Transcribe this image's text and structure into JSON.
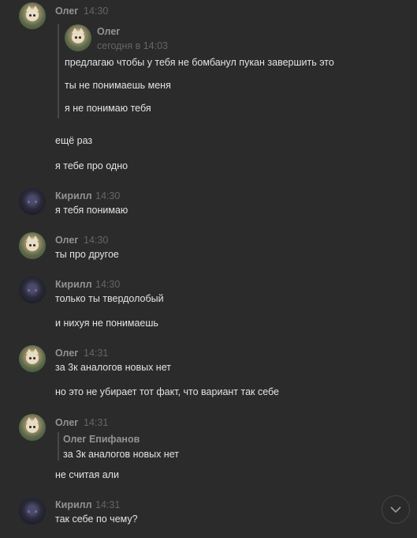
{
  "messages": [
    {
      "author": "Олег",
      "time": "14:30"
    },
    {
      "author": "Кирилл",
      "time": "14:30"
    },
    {
      "author": "Олег",
      "time": "14:30"
    },
    {
      "author": "Кирилл",
      "time": "14:30"
    },
    {
      "author": "Олег",
      "time": "14:31"
    },
    {
      "author": "Олег",
      "time": "14:31"
    },
    {
      "author": "Кирилл",
      "time": "14:31"
    }
  ],
  "quote1": {
    "author": "Олег",
    "time": "сегодня в 14:03",
    "lines": [
      "предлагаю чтобы у тебя не бомбанул пукан завершить это",
      "ты не понимаешь меня",
      "я не понимаю тебя"
    ]
  },
  "quote2": {
    "author": "Олег Епифанов",
    "text": "за 3к аналогов новых нет"
  },
  "texts": {
    "again": "ещё раз",
    "one_thing": "я тебе про одно",
    "understand": "я тебя понимаю",
    "other": "ты про другое",
    "stubborn": "только ты твердолобый",
    "nothing": "и нихуя не понимаешь",
    "analogs": "за 3к аналогов новых нет",
    "fact": "но это не убирает тот факт, что вариант так себе",
    "ali": "не считая али",
    "why": "так себе по чему?"
  },
  "icons": {
    "scroll_down": "chevron-down-icon"
  },
  "colors": {
    "background": "#2b2b2c",
    "text": "#e1e3e6",
    "author": "#939393",
    "time": "#656565"
  }
}
